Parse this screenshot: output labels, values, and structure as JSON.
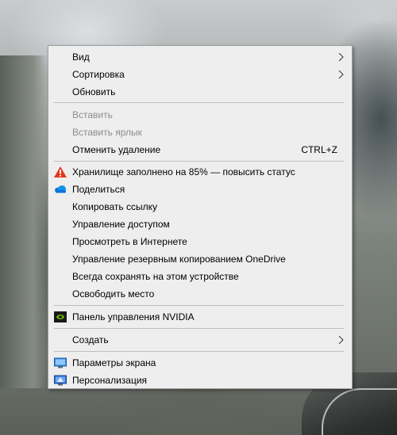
{
  "menu": {
    "view": "Вид",
    "sort": "Сортировка",
    "refresh": "Обновить",
    "paste": "Вставить",
    "paste_shortcut": "Вставить ярлык",
    "undo_delete": "Отменить удаление",
    "undo_shortcut": "CTRL+Z",
    "storage_full": "Хранилище заполнено на 85% — повысить статус",
    "share": "Поделиться",
    "copy_link": "Копировать ссылку",
    "manage_access": "Управление доступом",
    "view_online": "Просмотреть в Интернете",
    "manage_backup": "Управление резервным копированием OneDrive",
    "always_keep": "Всегда сохранять на этом устройстве",
    "free_space": "Освободить место",
    "nvidia": "Панель управления NVIDIA",
    "create": "Создать",
    "display_settings": "Параметры экрана",
    "personalize": "Персонализация"
  },
  "icons": {
    "warning": "warning-triangle-icon",
    "share": "onedrive-cloud-icon",
    "nvidia": "nvidia-icon",
    "display": "display-settings-icon",
    "personalize": "personalization-icon"
  },
  "colors": {
    "menu_bg": "#eeeeee",
    "disabled_text": "#8c8c8c",
    "warning": "#e03a1e",
    "onedrive": "#0a74d6",
    "nvidia": "#76b900"
  }
}
